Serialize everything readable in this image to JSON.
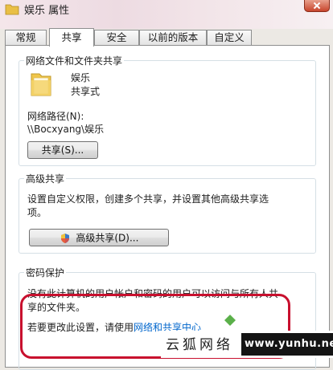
{
  "window": {
    "title": "娱乐 属性"
  },
  "tabs": [
    {
      "label": "常规"
    },
    {
      "label": "共享",
      "active": true
    },
    {
      "label": "安全"
    },
    {
      "label": "以前的版本"
    },
    {
      "label": "自定义"
    }
  ],
  "network_share": {
    "group_label": "网络文件和文件夹共享",
    "folder_name": "娱乐",
    "folder_status": "共享式",
    "path_label": "网络路径(N):",
    "path_value": "\\\\Bocxyang\\娱乐",
    "share_button": "共享(S)..."
  },
  "advanced_share": {
    "group_label": "高级共享",
    "description_line1": "设置自定义权限，创建多个共享，并设置其他高级共享选",
    "description_line2": "项。",
    "button": "高级共享(D)..."
  },
  "password_protection": {
    "group_label": "密码保护",
    "line1": "没有此计算机的用户帐户和密码的用户可以访问与所有人共",
    "line2": "享的文件夹。",
    "change_prefix": "若要更改此设置，请使用",
    "change_link": "网络和共享中心"
  },
  "watermark": {
    "left_text": "云狐网络",
    "url": "www.yunhu.net"
  },
  "colors": {
    "highlight": "#c8102e",
    "link": "#0066cc",
    "folder": "#f0c64a"
  }
}
